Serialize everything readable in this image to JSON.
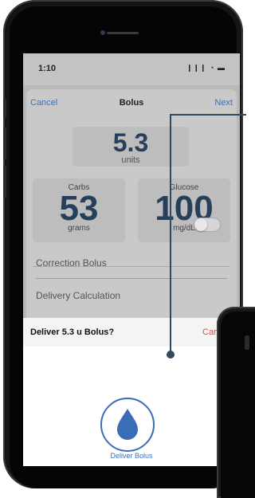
{
  "status_bar": {
    "time": "1:10",
    "indicators": "❙❙❙ ◔ ▬"
  },
  "nav": {
    "cancel_label": "Cancel",
    "title": "Bolus",
    "next_label": "Next"
  },
  "bolus_amount": {
    "value": "5.3",
    "unit": "units"
  },
  "carbs": {
    "label": "Carbs",
    "value": "53",
    "unit": "grams"
  },
  "glucose": {
    "label": "Glucose",
    "value": "100",
    "unit": "mg/dL"
  },
  "correction_bolus": {
    "label": "Correction Bolus",
    "enabled": false
  },
  "delivery_calculation": {
    "label": "Delivery Calculation"
  },
  "alert": {
    "title": "Deliver 5.3 u Bolus?",
    "cancel_label": "Can",
    "deliver_label": "Deliver Bolus"
  },
  "colors": {
    "accent": "#3a6db5",
    "value_text": "#273f5b",
    "cancel_red": "#e04c4c",
    "callout": "#2f4960"
  },
  "icons": {
    "deliver": "water-drop-icon"
  }
}
